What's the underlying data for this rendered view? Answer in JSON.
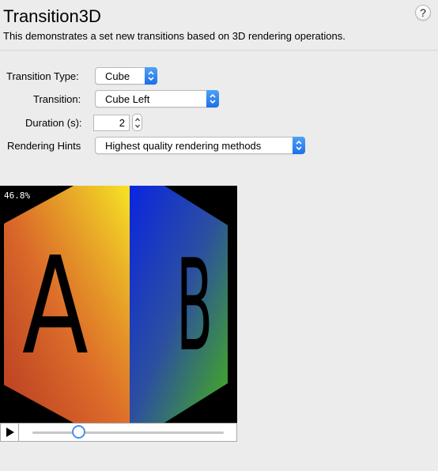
{
  "header": {
    "title": "Transition3D",
    "subtitle": "This demonstrates a set new transitions based on 3D rendering operations.",
    "help_label": "?"
  },
  "form": {
    "transition_type": {
      "label": "Transition Type:",
      "value": "Cube"
    },
    "transition": {
      "label": "Transition:",
      "value": "Cube Left"
    },
    "duration": {
      "label": "Duration (s):",
      "value": "2"
    },
    "rendering_hints": {
      "label": "Rendering Hints",
      "value": "Highest quality rendering methods"
    }
  },
  "preview": {
    "progress_text": "46.8%",
    "progress": 0.468,
    "face_left_letter": "A",
    "face_right_letter": "B"
  },
  "playback": {
    "position": 0.24
  },
  "colors": {
    "accent": "#1d6fe8",
    "background": "#ececec"
  }
}
